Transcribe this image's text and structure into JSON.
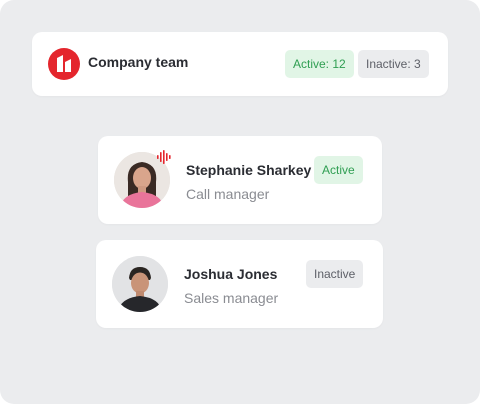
{
  "company": {
    "name": "Company team",
    "active_badge": "Active: 12",
    "inactive_badge": "Inactive: 3",
    "logo_color": "#e4262d"
  },
  "members": [
    {
      "name": "Stephanie Sharkey",
      "role": "Call manager",
      "status": "Active",
      "icon": "voice-wave-icon"
    },
    {
      "name": "Joshua Jones",
      "role": "Sales manager",
      "status": "Inactive"
    }
  ],
  "colors": {
    "accent_red": "#e4262d",
    "active_green": "#2f9e52",
    "active_bg": "#e1f5e6",
    "inactive_bg": "#ebecee"
  }
}
